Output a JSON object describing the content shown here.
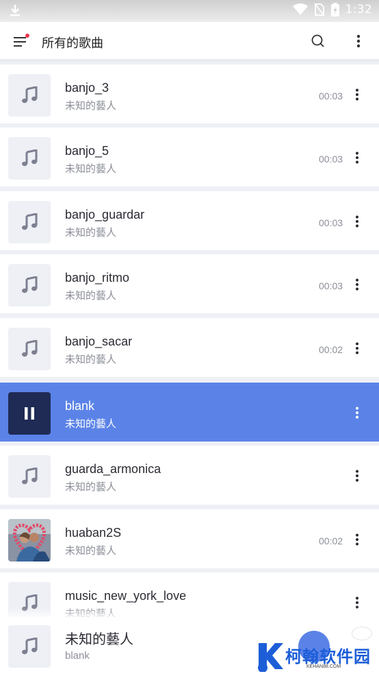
{
  "status_bar": {
    "time": "1:32"
  },
  "app_bar": {
    "title": "所有的歌曲"
  },
  "songs": [
    {
      "title": "banjo_3",
      "artist": "未知的藝人",
      "duration": "00:03"
    },
    {
      "title": "banjo_5",
      "artist": "未知的藝人",
      "duration": "00:03"
    },
    {
      "title": "banjo_guardar",
      "artist": "未知的藝人",
      "duration": "00:03"
    },
    {
      "title": "banjo_ritmo",
      "artist": "未知的藝人",
      "duration": "00:03"
    },
    {
      "title": "banjo_sacar",
      "artist": "未知的藝人",
      "duration": "00:02"
    },
    {
      "title": "blank",
      "artist": "未知的藝人",
      "duration": ""
    },
    {
      "title": "guarda_armonica",
      "artist": "未知的藝人",
      "duration": ""
    },
    {
      "title": "huaban2S",
      "artist": "未知的藝人",
      "duration": "00:02"
    },
    {
      "title": "music_new_york_love",
      "artist": "未知的藝人",
      "duration": ""
    }
  ],
  "now_playing": {
    "title": "未知的藝人",
    "subtitle": "blank"
  },
  "watermark": {
    "text": "柯翰软件园",
    "sub": "KEHAN88.COM"
  },
  "colors": {
    "accent": "#5b83e7",
    "active_thumb": "#1f2b55",
    "badge": "#f0364f"
  }
}
